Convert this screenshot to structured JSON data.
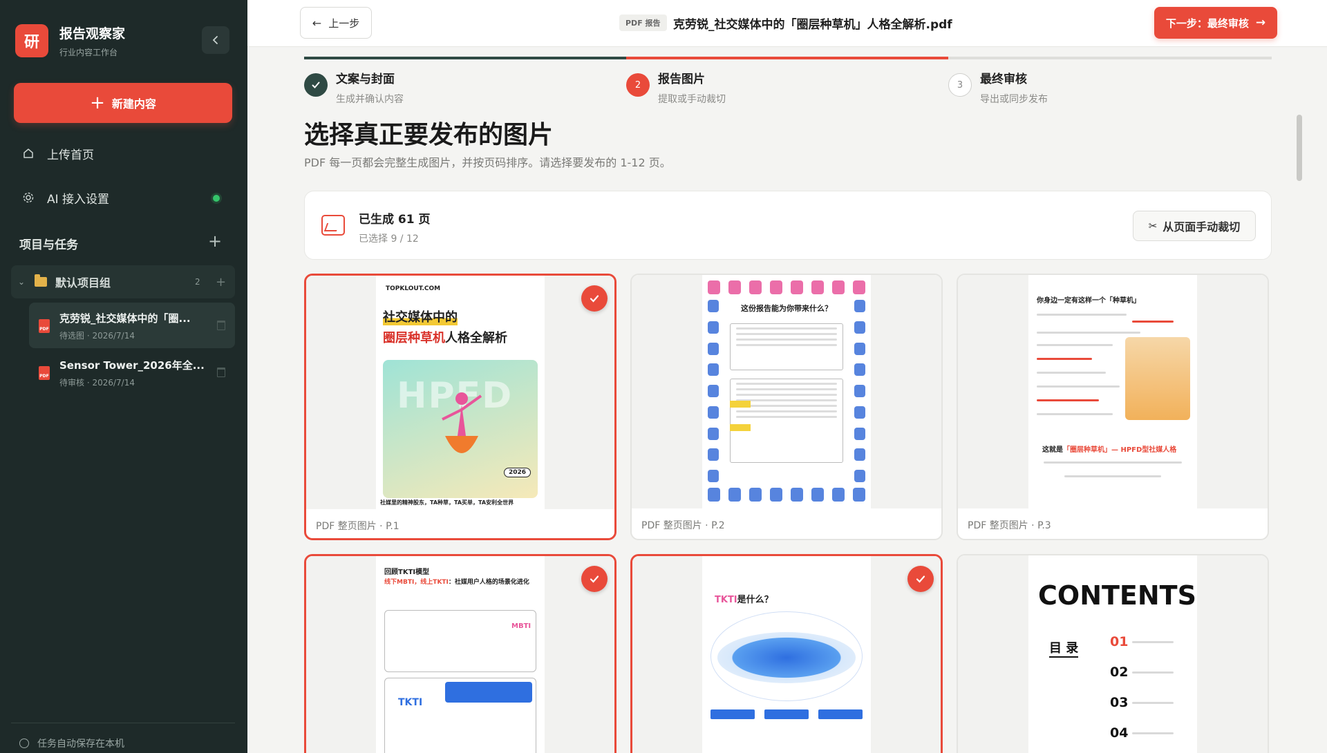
{
  "sidebar": {
    "logo_char": "研",
    "brand_title": "报告观察家",
    "brand_subtitle": "行业内容工作台",
    "new_button_label": "新建内容",
    "nav": [
      {
        "label": "上传首页",
        "icon": "home-icon"
      },
      {
        "label": "AI 接入设置",
        "icon": "gear-icon",
        "status": "connected"
      }
    ],
    "section_title": "项目与任务",
    "group": {
      "name": "默认项目组",
      "count": "2"
    },
    "tasks": [
      {
        "title": "克劳锐_社交媒体中的「圈...",
        "meta": "待选图 · 2026/7/14",
        "active": true
      },
      {
        "title": "Sensor Tower_2026年全...",
        "meta": "待审核 · 2026/7/14",
        "active": false
      }
    ],
    "footer_text": "任务自动保存在本机"
  },
  "topbar": {
    "back_label": "上一步",
    "doc_badge": "PDF 报告",
    "doc_title": "克劳锐_社交媒体中的「圈层种草机」人格全解析.pdf",
    "next_label": "下一步：最终审核"
  },
  "steps": [
    {
      "index": "1",
      "title": "文案与封面",
      "subtitle": "生成并确认内容",
      "state": "done"
    },
    {
      "index": "2",
      "title": "报告图片",
      "subtitle": "提取或手动裁切",
      "state": "active"
    },
    {
      "index": "3",
      "title": "最终审核",
      "subtitle": "导出或同步发布",
      "state": "pending"
    }
  ],
  "main": {
    "title": "选择真正要发布的图片",
    "description": "PDF 每一页都会完整生成图片，并按页码排序。请选择要发布的 1-12 页。",
    "summary_title": "已生成 61 页",
    "summary_sub": "已选择 9 / 12",
    "crop_label": "从页面手动裁切"
  },
  "pages": [
    {
      "caption": "PDF 整页图片 · P.1",
      "selected": true
    },
    {
      "caption": "PDF 整页图片 · P.2",
      "selected": false
    },
    {
      "caption": "PDF 整页图片 · P.3",
      "selected": false
    },
    {
      "caption": "PDF 整页图片 · P.4",
      "selected": true
    },
    {
      "caption": "PDF 整页图片 · P.5",
      "selected": true
    },
    {
      "caption": "PDF 整页图片 · P.6",
      "selected": false
    }
  ],
  "thumb_text": {
    "p1_brand": "TOPKLOUT.COM",
    "p1_h1": "社交媒体中的",
    "p1_h2a": "圈层种草机",
    "p1_h2b": "人格全解析",
    "p1_big": "HPFD",
    "p1_year": "2026",
    "p1_foot": "社媒里的精神股东，TA种草，TA买单，TA安利全世界",
    "p2_title": "这份报告能为你带来什么？",
    "p3_title": "你身边一定有这样一个「种草机」",
    "p3_quote_a": "这就是",
    "p3_quote_b": "「圈层种草机」— HPFD型社媒人格",
    "p4_title": "回顾TKTI模型",
    "p4_sub_a": "线下MBTI，线上TKTI",
    "p4_sub_b": "：社媒用户人格的场景化进化",
    "p4_mbti": "MBTI",
    "p4_tkti": "TKTI",
    "p5_title_a": "TKTI",
    "p5_title_b": "是什么？",
    "p6_contents": "CONTENTS",
    "p6_mulu": "目 录",
    "p6_nums": [
      "01",
      "02",
      "03",
      "04"
    ]
  },
  "colors": {
    "accent": "#e94a3a",
    "sidebar_bg": "#1e2a29",
    "success": "#35c46a"
  }
}
